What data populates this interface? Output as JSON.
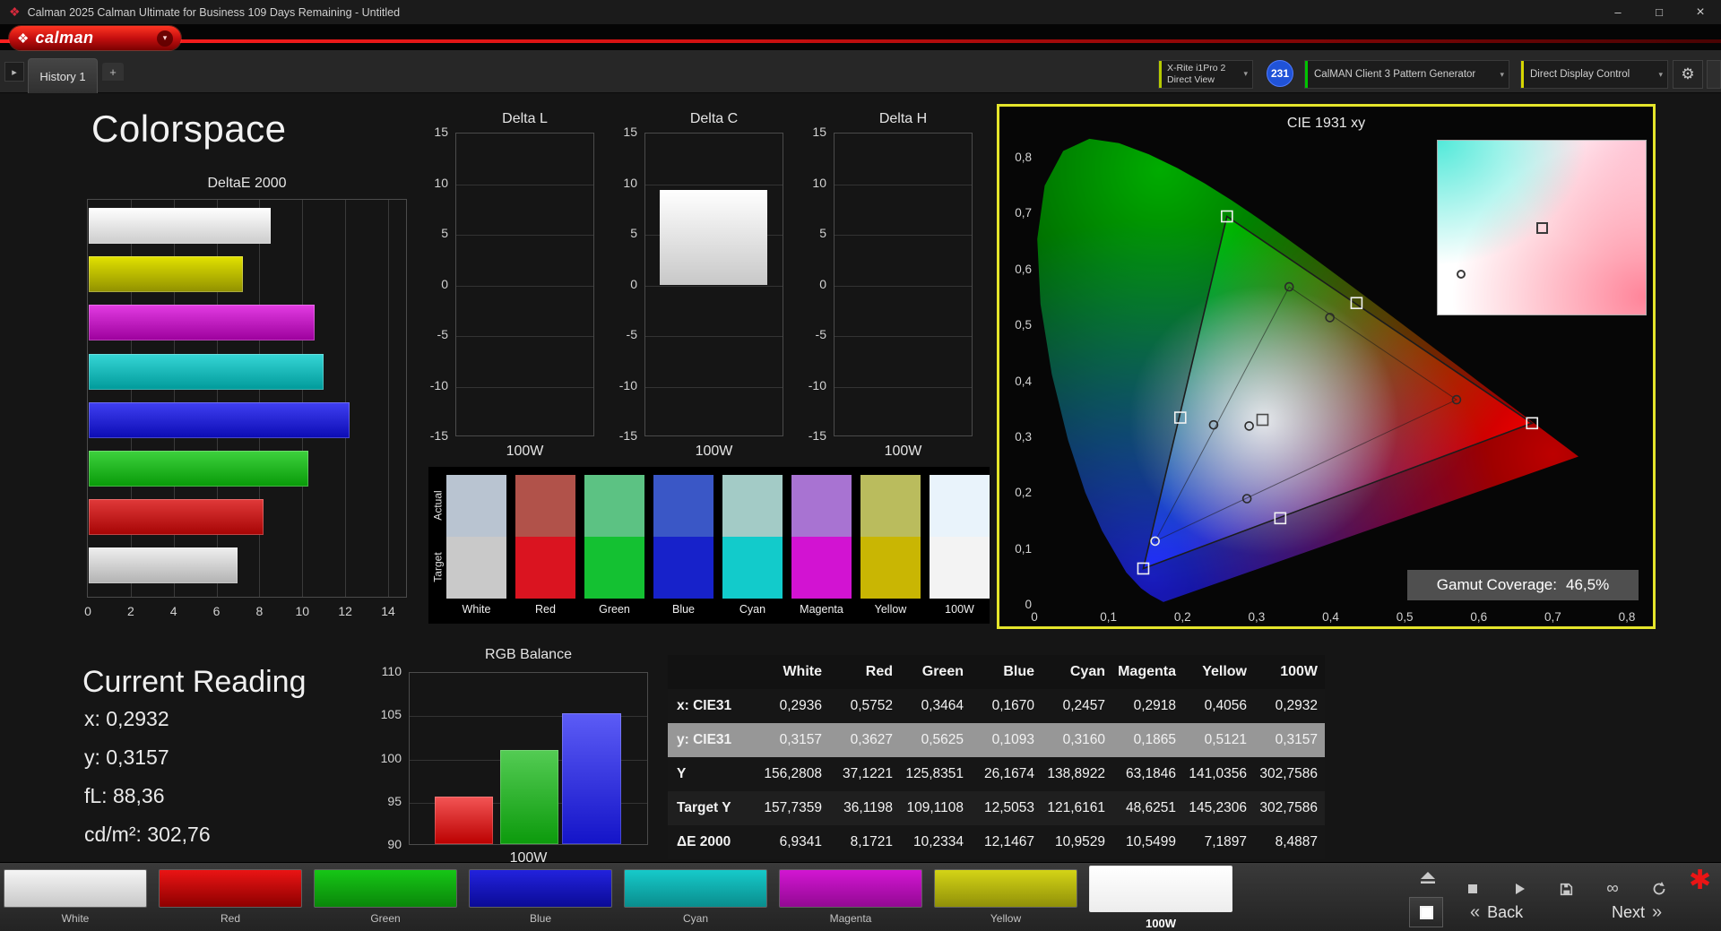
{
  "icons": {
    "app": "❖",
    "logo_mark": "❖",
    "dropdown_caret": "▾",
    "gear": "⚙",
    "nav_arrow": "▸",
    "add_tab": "+",
    "minimize": "–",
    "maximize": "□",
    "close": "×",
    "back_chevrons": "«",
    "next_chevrons": "»",
    "link_infinity": "∞",
    "brand_asterisk": "✱"
  },
  "window": {
    "title": "Calman 2025 Calman Ultimate for Business 109 Days Remaining  - Untitled"
  },
  "toolbar": {
    "logo_text": "calman",
    "device_selector": {
      "line1": "X-Rite i1Pro 2",
      "line2": "Direct View"
    },
    "badge_count": "231",
    "pattern_generator": "CalMAN Client 3 Pattern Generator",
    "display_control": "Direct Display Control"
  },
  "tab_bar": {
    "active_tab": "History 1"
  },
  "page": {
    "title": "Colorspace"
  },
  "charts": {
    "deltae": {
      "title": "DeltaE 2000",
      "xmax": 14,
      "xticks": [
        0,
        2,
        4,
        6,
        8,
        10,
        12,
        14
      ],
      "bars": [
        {
          "name": "white",
          "value": 8.49,
          "c1": "#ffffff",
          "c2": "#cccccc"
        },
        {
          "name": "yellow",
          "value": 7.19,
          "c1": "#e2e200",
          "c2": "#909000"
        },
        {
          "name": "magenta",
          "value": 10.55,
          "c1": "#e33ce3",
          "c2": "#9c009c"
        },
        {
          "name": "cyan",
          "value": 10.95,
          "c1": "#36d6d6",
          "c2": "#009a9a"
        },
        {
          "name": "blue",
          "value": 12.15,
          "c1": "#4040f2",
          "c2": "#0b0bb4"
        },
        {
          "name": "green",
          "value": 10.23,
          "c1": "#3ed23e",
          "c2": "#089a08"
        },
        {
          "name": "red",
          "value": 8.17,
          "c1": "#e13a3a",
          "c2": "#a60404"
        },
        {
          "name": "100w",
          "value": 6.93,
          "c1": "#efefef",
          "c2": "#b2b2b2"
        }
      ]
    },
    "delta_lch": {
      "ymin": -15,
      "ymax": 15,
      "yticks": [
        15,
        10,
        5,
        0,
        -5,
        -10,
        -15
      ],
      "xlabel": "100W",
      "charts": [
        {
          "title": "Delta L",
          "value": null
        },
        {
          "title": "Delta C",
          "value": 9.4
        },
        {
          "title": "Delta H",
          "value": null
        }
      ]
    },
    "rgb_balance": {
      "title": "RGB Balance",
      "xlabel": "100W",
      "ymin": 90,
      "ymax": 110,
      "yticks": [
        110,
        105,
        100,
        95,
        90
      ],
      "bars": [
        {
          "name": "red",
          "value": 95.5,
          "c1": "#f35555",
          "c2": "#bb0000"
        },
        {
          "name": "green",
          "value": 101.0,
          "c1": "#54cc54",
          "c2": "#0c9a0c"
        },
        {
          "name": "blue",
          "value": 105.3,
          "c1": "#5c5cf6",
          "c2": "#1414c8"
        }
      ]
    }
  },
  "swatch_compare": {
    "row_labels": [
      "Actual",
      "Target"
    ],
    "columns": [
      "White",
      "Red",
      "Green",
      "Blue",
      "Cyan",
      "Magenta",
      "Yellow",
      "100W"
    ],
    "actual": [
      "#b9c4d1",
      "#b1524a",
      "#5cc283",
      "#3a57c6",
      "#a3cbc6",
      "#a873d2",
      "#babc5d",
      "#e9f3fb"
    ],
    "target": [
      "#c9c9c9",
      "#da1420",
      "#14c132",
      "#1722ca",
      "#12cbcb",
      "#d213d2",
      "#c9b603",
      "#f3f3f3"
    ]
  },
  "cie": {
    "title": "CIE 1931 xy",
    "xticks": [
      "0",
      "0,1",
      "0,2",
      "0,3",
      "0,4",
      "0,5",
      "0,6",
      "0,7",
      "0,8"
    ],
    "yticks": [
      "0,8",
      "0,7",
      "0,6",
      "0,5",
      "0,4",
      "0,3",
      "0,2",
      "0,1",
      "0"
    ],
    "gamut_label": "Gamut Coverage:",
    "gamut_value": "46,5%",
    "target_triangle": [
      [
        0.26,
        0.695
      ],
      [
        0.672,
        0.325
      ],
      [
        0.147,
        0.065
      ]
    ],
    "measured_triangle": [
      [
        0.344,
        0.569
      ],
      [
        0.57,
        0.367
      ],
      [
        0.163,
        0.114
      ]
    ],
    "target_points": [
      {
        "name": "white",
        "x": 0.308,
        "y": 0.331,
        "stroke": "#4a4a4a"
      },
      {
        "name": "green",
        "x": 0.26,
        "y": 0.695,
        "stroke": "#f2f2f2"
      },
      {
        "name": "yellow",
        "x": 0.435,
        "y": 0.54,
        "stroke": "#f2f2f2"
      },
      {
        "name": "red",
        "x": 0.672,
        "y": 0.325,
        "stroke": "#f2f2f2"
      },
      {
        "name": "magenta",
        "x": 0.332,
        "y": 0.155,
        "stroke": "#f2f2f2"
      },
      {
        "name": "blue",
        "x": 0.147,
        "y": 0.065,
        "stroke": "#f2f2f2"
      },
      {
        "name": "cyan",
        "x": 0.197,
        "y": 0.335,
        "stroke": "#f2f2f2"
      }
    ],
    "measured_points": [
      {
        "name": "white",
        "x": 0.29,
        "y": 0.32,
        "stroke": "#2a2a2a"
      },
      {
        "name": "green",
        "x": 0.344,
        "y": 0.569,
        "stroke": "#2a2a2a"
      },
      {
        "name": "yellow",
        "x": 0.399,
        "y": 0.514,
        "stroke": "#2a2a2a"
      },
      {
        "name": "red",
        "x": 0.57,
        "y": 0.367,
        "stroke": "#2a2a2a"
      },
      {
        "name": "magenta",
        "x": 0.287,
        "y": 0.19,
        "stroke": "#2a2a2a"
      },
      {
        "name": "blue",
        "x": 0.163,
        "y": 0.114,
        "stroke": "#e8e8e8"
      },
      {
        "name": "cyan",
        "x": 0.242,
        "y": 0.322,
        "stroke": "#2a2a2a"
      }
    ],
    "inset": {
      "square": {
        "fx": 0.5,
        "fy": 0.5
      },
      "circle": {
        "fx": 0.11,
        "fy": 0.76
      }
    }
  },
  "current_reading": {
    "title": "Current Reading",
    "items": [
      {
        "key": "x",
        "label": "x:",
        "value": "0,2932"
      },
      {
        "key": "y",
        "label": "y:",
        "value": "0,3157"
      },
      {
        "key": "fl",
        "label": "fL:",
        "value": "88,36"
      },
      {
        "key": "cdm2",
        "label": "cd/m²:",
        "value": "302,76"
      }
    ]
  },
  "table": {
    "columns": [
      "White",
      "Red",
      "Green",
      "Blue",
      "Cyan",
      "Magenta",
      "Yellow",
      "100W"
    ],
    "rows": [
      {
        "label": "x: CIE31",
        "highlight": false,
        "values": [
          "0,2936",
          "0,5752",
          "0,3464",
          "0,1670",
          "0,2457",
          "0,2918",
          "0,4056",
          "0,2932"
        ]
      },
      {
        "label": "y: CIE31",
        "highlight": true,
        "values": [
          "0,3157",
          "0,3627",
          "0,5625",
          "0,1093",
          "0,3160",
          "0,1865",
          "0,5121",
          "0,3157"
        ]
      },
      {
        "label": "Y",
        "highlight": false,
        "values": [
          "156,2808",
          "37,1221",
          "125,8351",
          "26,1674",
          "138,8922",
          "63,1846",
          "141,0356",
          "302,7586"
        ]
      },
      {
        "label": "Target Y",
        "highlight": false,
        "values": [
          "157,7359",
          "36,1198",
          "109,1108",
          "12,5053",
          "121,6161",
          "48,6251",
          "145,2306",
          "302,7586"
        ]
      },
      {
        "label": "ΔE 2000",
        "highlight": false,
        "values": [
          "6,9341",
          "8,1721",
          "10,2334",
          "12,1467",
          "10,9529",
          "10,5499",
          "7,1897",
          "8,4887"
        ]
      }
    ]
  },
  "bottom_bar": {
    "patterns": [
      {
        "label": "White",
        "c1": "#f5f5f5",
        "c2": "#c8c8c8",
        "selected": false
      },
      {
        "label": "Red",
        "c1": "#ea1414",
        "c2": "#8d0000",
        "selected": false
      },
      {
        "label": "Green",
        "c1": "#16c616",
        "c2": "#0a870a",
        "selected": false
      },
      {
        "label": "Blue",
        "c1": "#2222dd",
        "c2": "#0b0b96",
        "selected": false
      },
      {
        "label": "Cyan",
        "c1": "#16caca",
        "c2": "#0a8d8d",
        "selected": false
      },
      {
        "label": "Magenta",
        "c1": "#d216d2",
        "c2": "#930993",
        "selected": false
      },
      {
        "label": "Yellow",
        "c1": "#d4d416",
        "c2": "#909009",
        "selected": false
      },
      {
        "label": "100W",
        "c1": "#ffffff",
        "c2": "#ededed",
        "selected": true
      }
    ],
    "back_label": "Back",
    "next_label": "Next"
  }
}
